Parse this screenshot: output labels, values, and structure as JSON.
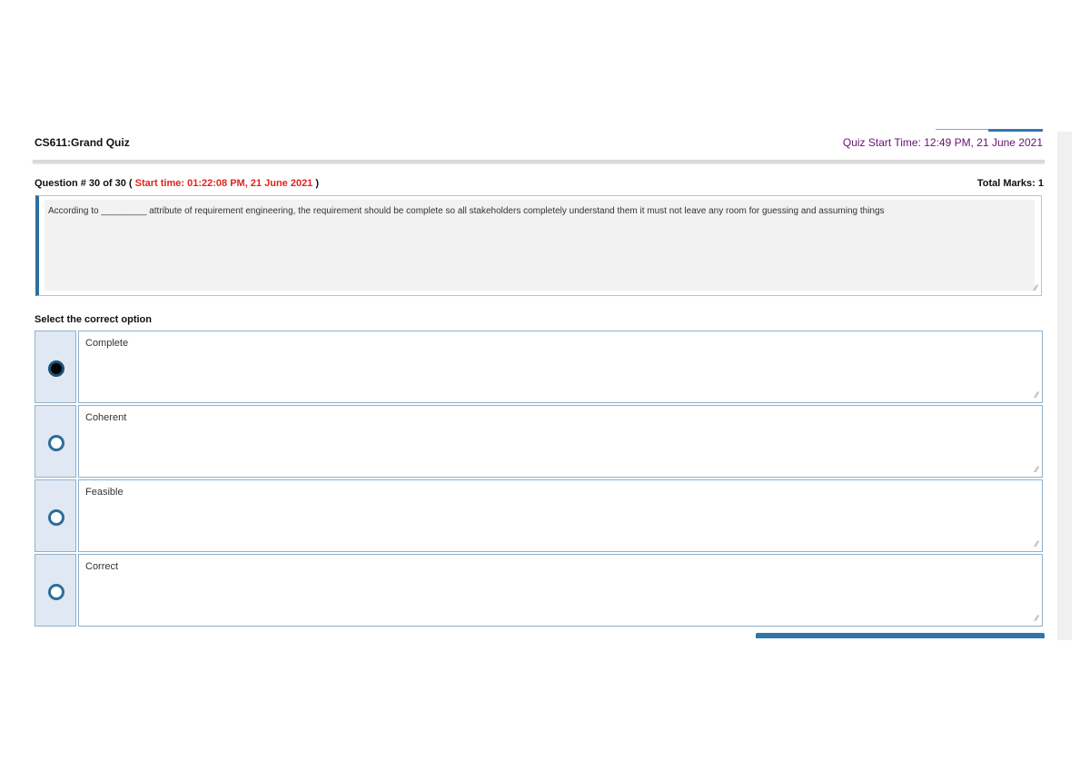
{
  "header": {
    "quiz_title": "CS611:Grand Quiz",
    "quiz_start_time": "Quiz Start Time: 12:49 PM, 21 June 2021"
  },
  "question": {
    "number_label": "Question # 30 of 30 (",
    "start_time": "Start time: 01:22:08 PM, 21 June 2021",
    "close_paren": ")",
    "total_marks": "Total Marks: 1",
    "text": "According to _________ attribute of requirement engineering, the requirement should be complete so all stakeholders completely understand them it must not leave any room for guessing and assuming things"
  },
  "select_label": "Select the correct option",
  "options": [
    {
      "label": "Complete",
      "selected": true
    },
    {
      "label": "Coherent",
      "selected": false
    },
    {
      "label": "Feasible",
      "selected": false
    },
    {
      "label": "Correct",
      "selected": false
    }
  ],
  "colors": {
    "accent": "#2e6f9e",
    "start_time_red": "#e2231a",
    "quiz_time_purple": "#6a0f75"
  },
  "icons": {
    "resize_grip": "resize-grip-icon",
    "radio": "radio-button"
  }
}
